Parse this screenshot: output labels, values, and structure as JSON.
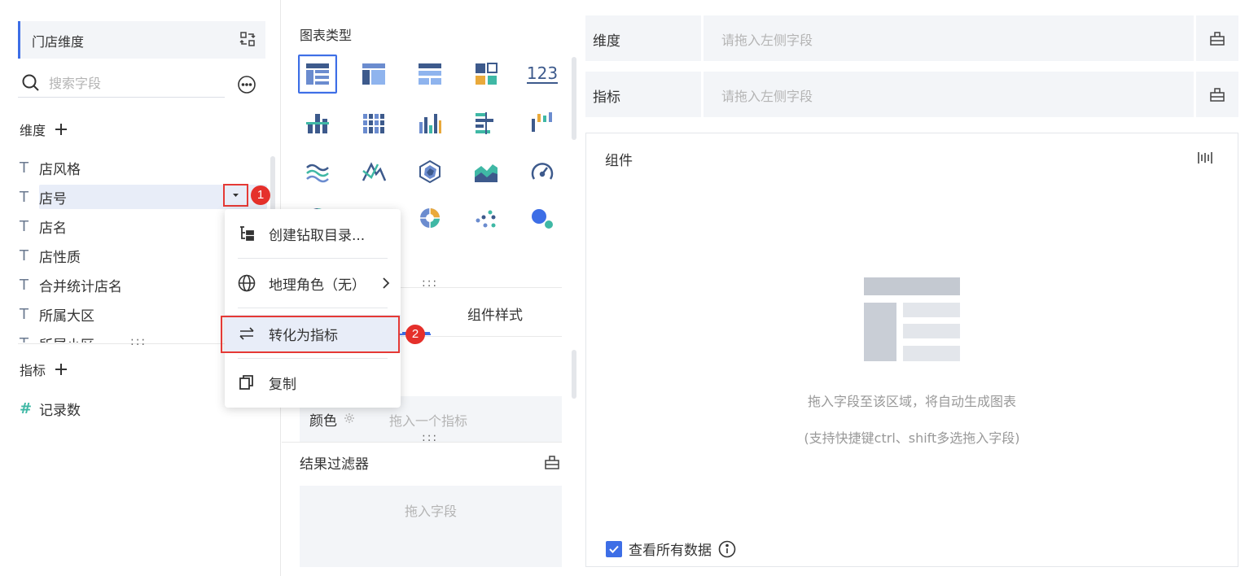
{
  "left": {
    "dataset": "门店维度",
    "search_placeholder": "搜索字段",
    "dimensions_title": "维度",
    "dimension_fields": [
      {
        "type": "T",
        "name": "店风格"
      },
      {
        "type": "T",
        "name": "店号"
      },
      {
        "type": "T",
        "name": "店名"
      },
      {
        "type": "T",
        "name": "店性质"
      },
      {
        "type": "T",
        "name": "合并统计店名"
      },
      {
        "type": "T",
        "name": "所属大区"
      },
      {
        "type": "T",
        "name": "所属小区"
      }
    ],
    "selected_field": "店号",
    "measures_title": "指标",
    "measure_fields": [
      {
        "type": "#",
        "name": "记录数"
      }
    ],
    "splitter": ":::"
  },
  "annotations": {
    "badge1": "1",
    "badge2": "2"
  },
  "context_menu": {
    "items": [
      {
        "label": "创建钻取目录...",
        "icon": "drill-tree-icon"
      },
      {
        "label": "地理角色（无）",
        "icon": "globe-icon",
        "has_submenu": true
      },
      {
        "label": "转化为指标",
        "icon": "swap-icon",
        "highlighted": true
      },
      {
        "label": "复制",
        "icon": "copy-icon"
      }
    ]
  },
  "middle": {
    "chart_type_title": "图表类型",
    "chart_types": [
      "table-icon",
      "cross-table-icon",
      "detail-table-icon",
      "kpi-card-icon",
      "number-card-icon",
      "bar-grouped-icon",
      "stacked-bar-icon",
      "column-icon",
      "horizontal-bar-icon",
      "waterfall-icon",
      "line-wave-icon",
      "line-chart-icon",
      "radar-icon",
      "area-chart-icon",
      "gauge-icon",
      "pie-icon",
      "rose-icon",
      "ring-icon",
      "scatter-icon",
      "bubble-icon"
    ],
    "number_card_text": "123",
    "tab_style": "组件样式",
    "color_label": "颜色",
    "color_placeholder": "拖入一个指标",
    "filter_title": "结果过滤器",
    "filter_placeholder": "拖入字段",
    "splitter": ":::"
  },
  "right": {
    "dimension_shelf": {
      "label": "维度",
      "placeholder": "请拖入左侧字段"
    },
    "measure_shelf": {
      "label": "指标",
      "placeholder": "请拖入左侧字段"
    },
    "widget_title": "组件",
    "empty_hint": "拖入字段至该区域，将自动生成图表",
    "empty_hint_sub": "(支持快捷键ctrl、shift多选拖入字段)",
    "view_all_label": "查看所有数据",
    "view_all_checked": true
  },
  "colors": {
    "accent": "#3d6ee6",
    "annotation_red": "#e5302b",
    "panel_bg": "#f3f5f8",
    "measure_teal": "#3fb8a5"
  }
}
